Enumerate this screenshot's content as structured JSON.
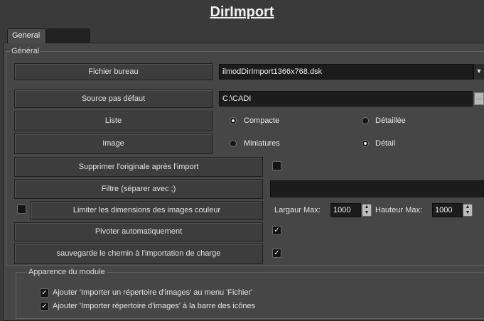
{
  "window": {
    "title": "DirImport"
  },
  "tabs": [
    {
      "label": "General",
      "active": true
    },
    {
      "label": "",
      "active": false
    }
  ],
  "general_group": {
    "legend": "Général"
  },
  "rows": {
    "fichier_bureau": {
      "label": "Fichier bureau",
      "value": "ilmodDirImport1366x768.dsk"
    },
    "source": {
      "label": "Source pas défaut",
      "value": "C:\\CADI",
      "browse": "..."
    },
    "liste": {
      "label": "Liste",
      "options": [
        "Compacte",
        "Détaillée"
      ],
      "selected": "Compacte"
    },
    "image": {
      "label": "Image",
      "options": [
        "Miniatures",
        "Détail"
      ],
      "selected": "Détail"
    },
    "supprimer": {
      "label": "Supprimer l'originale après l'import",
      "checked": false
    },
    "filtre": {
      "label": "Filtre (séparer avec ;)",
      "value": ""
    },
    "limiter": {
      "label": "Limiter les dimensions des images couleur",
      "checked": false,
      "largeur_label": "Largaur Max:",
      "largeur_value": "1000",
      "hauteur_label": "Hauteur Max:",
      "hauteur_value": "1000"
    },
    "pivoter": {
      "label": "Pivoter automatiquement",
      "checked": true
    },
    "sauvegarde": {
      "label": "sauvegarde le chemin à l'importation de charge",
      "checked": true
    }
  },
  "apparence_group": {
    "legend": "Apparence du module",
    "items": [
      {
        "label": "Ajouter 'Importer un répertoire d'images' au menu 'Fichier'",
        "checked": true
      },
      {
        "label": "Ajouter 'Importer répertoire d'images' à la barre des icônes",
        "checked": true
      }
    ]
  },
  "icons": {
    "dropdown": "chevron-down-icon",
    "spin": "up-down-arrows-icon",
    "check": "checkmark-icon"
  },
  "colors": {
    "background": "#3a3a3a",
    "panel": "#464646",
    "field": "#1c1c1c"
  }
}
